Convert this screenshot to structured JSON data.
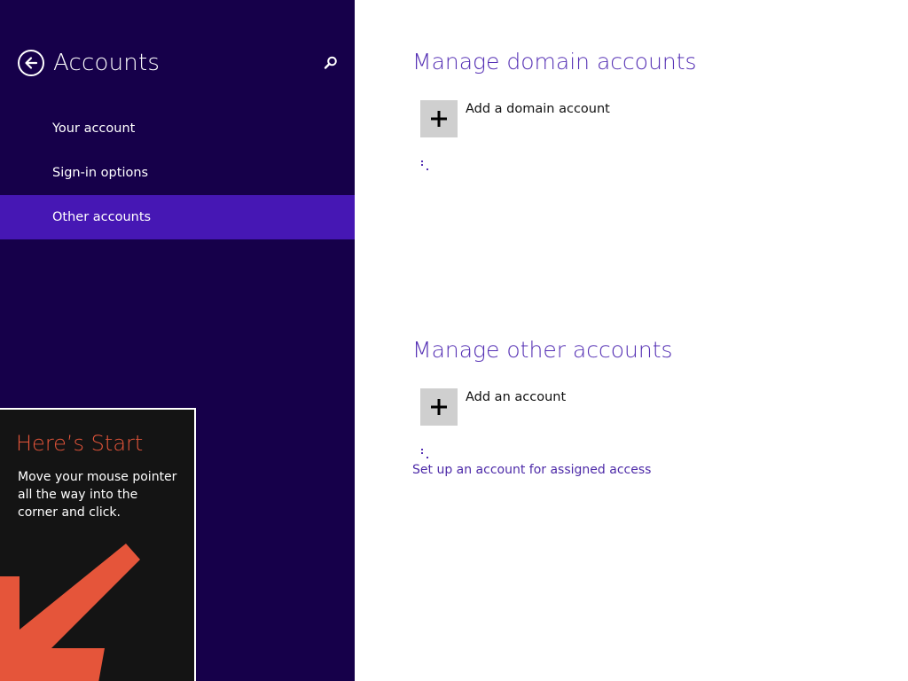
{
  "sidebar": {
    "title": "Accounts",
    "back_icon": "back-arrow-circle-icon",
    "search_icon": "search-icon",
    "items": [
      {
        "label": "Your account",
        "selected": false
      },
      {
        "label": "Sign-in options",
        "selected": false
      },
      {
        "label": "Other accounts",
        "selected": true
      }
    ]
  },
  "tip": {
    "title": "Here’s Start",
    "body": "Move your mouse pointer all the way into the corner and click.",
    "arrow_icon": "arrow-down-left-icon"
  },
  "main": {
    "domain": {
      "title": "Manage domain accounts",
      "add_label": "Add a domain account"
    },
    "other": {
      "title": "Manage other accounts",
      "add_label": "Add an account"
    },
    "assigned_access_link": "Set up an account for assigned access"
  },
  "colors": {
    "sidebar_bg": "#16004a",
    "selected_bg": "#4617b4",
    "accent": "#5530b4",
    "tip_title": "#e5553a",
    "tip_bg": "#141414",
    "tile_bg": "#cfcfcf"
  }
}
